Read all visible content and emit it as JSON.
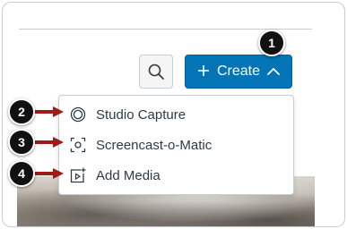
{
  "toolbar": {
    "create_label": "Create",
    "search_icon": "search-icon",
    "plus_icon": "plus-icon",
    "chevron_icon": "chevron-up-icon"
  },
  "menu": {
    "items": [
      {
        "label": "Studio Capture",
        "icon": "studio-capture-icon"
      },
      {
        "label": "Screencast-o-Matic",
        "icon": "screencast-icon"
      },
      {
        "label": "Add Media",
        "icon": "add-media-icon"
      }
    ]
  },
  "callouts": [
    "1",
    "2",
    "3",
    "4"
  ],
  "colors": {
    "primary_button": "#0374b5",
    "arrow": "#a01a1a",
    "callout_badge": "#111111",
    "menu_text": "#2d3b45"
  }
}
